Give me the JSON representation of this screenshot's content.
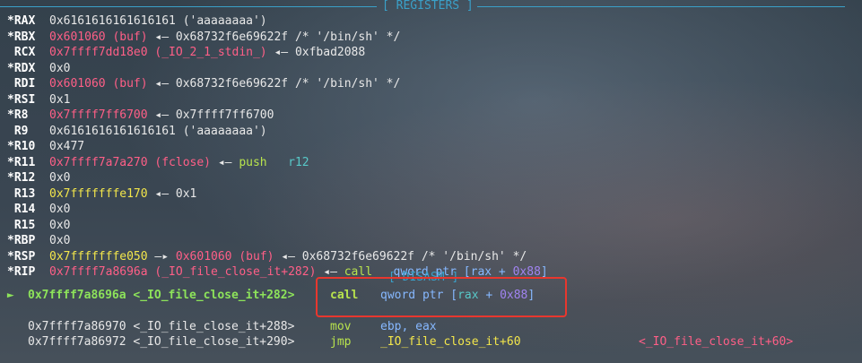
{
  "registers_header": "[ REGISTERS ]",
  "disasm_header": "[ DISASM ]",
  "registers": [
    {
      "name": "*RAX",
      "parts": [
        {
          "t": "0x6161616161616161 ('aaaaaaaa')",
          "c": "white"
        }
      ]
    },
    {
      "name": "*RBX",
      "parts": [
        {
          "t": "0x601060 (buf)",
          "c": "pink"
        },
        {
          "t": " ◂— 0x68732f6e69622f /* '/bin/sh' */",
          "c": "white"
        }
      ]
    },
    {
      "name": " RCX",
      "parts": [
        {
          "t": "0x7ffff7dd18e0 (_IO_2_1_stdin_)",
          "c": "pink"
        },
        {
          "t": " ◂— 0xfbad2088",
          "c": "white"
        }
      ]
    },
    {
      "name": "*RDX",
      "parts": [
        {
          "t": "0x0",
          "c": "white"
        }
      ]
    },
    {
      "name": " RDI",
      "parts": [
        {
          "t": "0x601060 (buf)",
          "c": "pink"
        },
        {
          "t": " ◂— 0x68732f6e69622f /* '/bin/sh' */",
          "c": "white"
        }
      ]
    },
    {
      "name": "*RSI",
      "parts": [
        {
          "t": "0x1",
          "c": "white"
        }
      ]
    },
    {
      "name": "*R8",
      "parts": [
        {
          "t": "0x7ffff7ff6700",
          "c": "pink"
        },
        {
          "t": " ◂— 0x7ffff7ff6700",
          "c": "white"
        }
      ]
    },
    {
      "name": " R9",
      "parts": [
        {
          "t": "0x6161616161616161 ('aaaaaaaa')",
          "c": "white"
        }
      ]
    },
    {
      "name": "*R10",
      "parts": [
        {
          "t": "0x477",
          "c": "white"
        }
      ]
    },
    {
      "name": "*R11",
      "parts": [
        {
          "t": "0x7ffff7a7a270 (fclose)",
          "c": "pink"
        },
        {
          "t": " ◂— ",
          "c": "white"
        },
        {
          "t": "push",
          "c": "green"
        },
        {
          "t": "   ",
          "c": "white"
        },
        {
          "t": "r12",
          "c": "teal"
        }
      ]
    },
    {
      "name": "*R12",
      "parts": [
        {
          "t": "0x0",
          "c": "white"
        }
      ]
    },
    {
      "name": " R13",
      "parts": [
        {
          "t": "0x7fffffffe170",
          "c": "yellow"
        },
        {
          "t": " ◂— 0x1",
          "c": "white"
        }
      ]
    },
    {
      "name": " R14",
      "parts": [
        {
          "t": "0x0",
          "c": "white"
        }
      ]
    },
    {
      "name": " R15",
      "parts": [
        {
          "t": "0x0",
          "c": "white"
        }
      ]
    },
    {
      "name": "*RBP",
      "parts": [
        {
          "t": "0x0",
          "c": "white"
        }
      ]
    },
    {
      "name": "*RSP",
      "parts": [
        {
          "t": "0x7fffffffe050",
          "c": "yellow"
        },
        {
          "t": " —▸ ",
          "c": "white"
        },
        {
          "t": "0x601060 (buf)",
          "c": "pink"
        },
        {
          "t": " ◂— 0x68732f6e69622f /* '/bin/sh' */",
          "c": "white"
        }
      ]
    },
    {
      "name": "*RIP",
      "parts": [
        {
          "t": "0x7ffff7a8696a (_IO_file_close_it+282)",
          "c": "pink"
        },
        {
          "t": " ◂— ",
          "c": "white"
        },
        {
          "t": "call",
          "c": "green"
        },
        {
          "t": "   qword ptr [rax + ",
          "c": "blue"
        },
        {
          "t": "0x88",
          "c": "purple"
        },
        {
          "t": "]",
          "c": "blue"
        }
      ]
    }
  ],
  "disasm": [
    {
      "marker": " ► ",
      "addr": "0x7ffff7a8696a <_IO_file_close_it+282>",
      "op": "call",
      "args": [
        {
          "t": "qword ptr [",
          "c": "blue"
        },
        {
          "t": "rax",
          "c": "teal"
        },
        {
          "t": " + ",
          "c": "blue"
        },
        {
          "t": "0x88",
          "c": "purple"
        },
        {
          "t": "]",
          "c": "blue"
        }
      ],
      "current": true,
      "extra": ""
    },
    {
      "marker": "",
      "addr": "0x7ffff7a86970 <_IO_file_close_it+288>",
      "op": "mov",
      "args": [
        {
          "t": "ebp, eax",
          "c": "blue"
        }
      ],
      "current": false,
      "extra": ""
    },
    {
      "marker": "",
      "addr": "0x7ffff7a86972 <_IO_file_close_it+290>",
      "op": "jmp",
      "args": [
        {
          "t": "_IO_file_close_it+60",
          "c": "yellow"
        }
      ],
      "current": false,
      "extra": "<_IO_file_close_it+60>"
    }
  ]
}
